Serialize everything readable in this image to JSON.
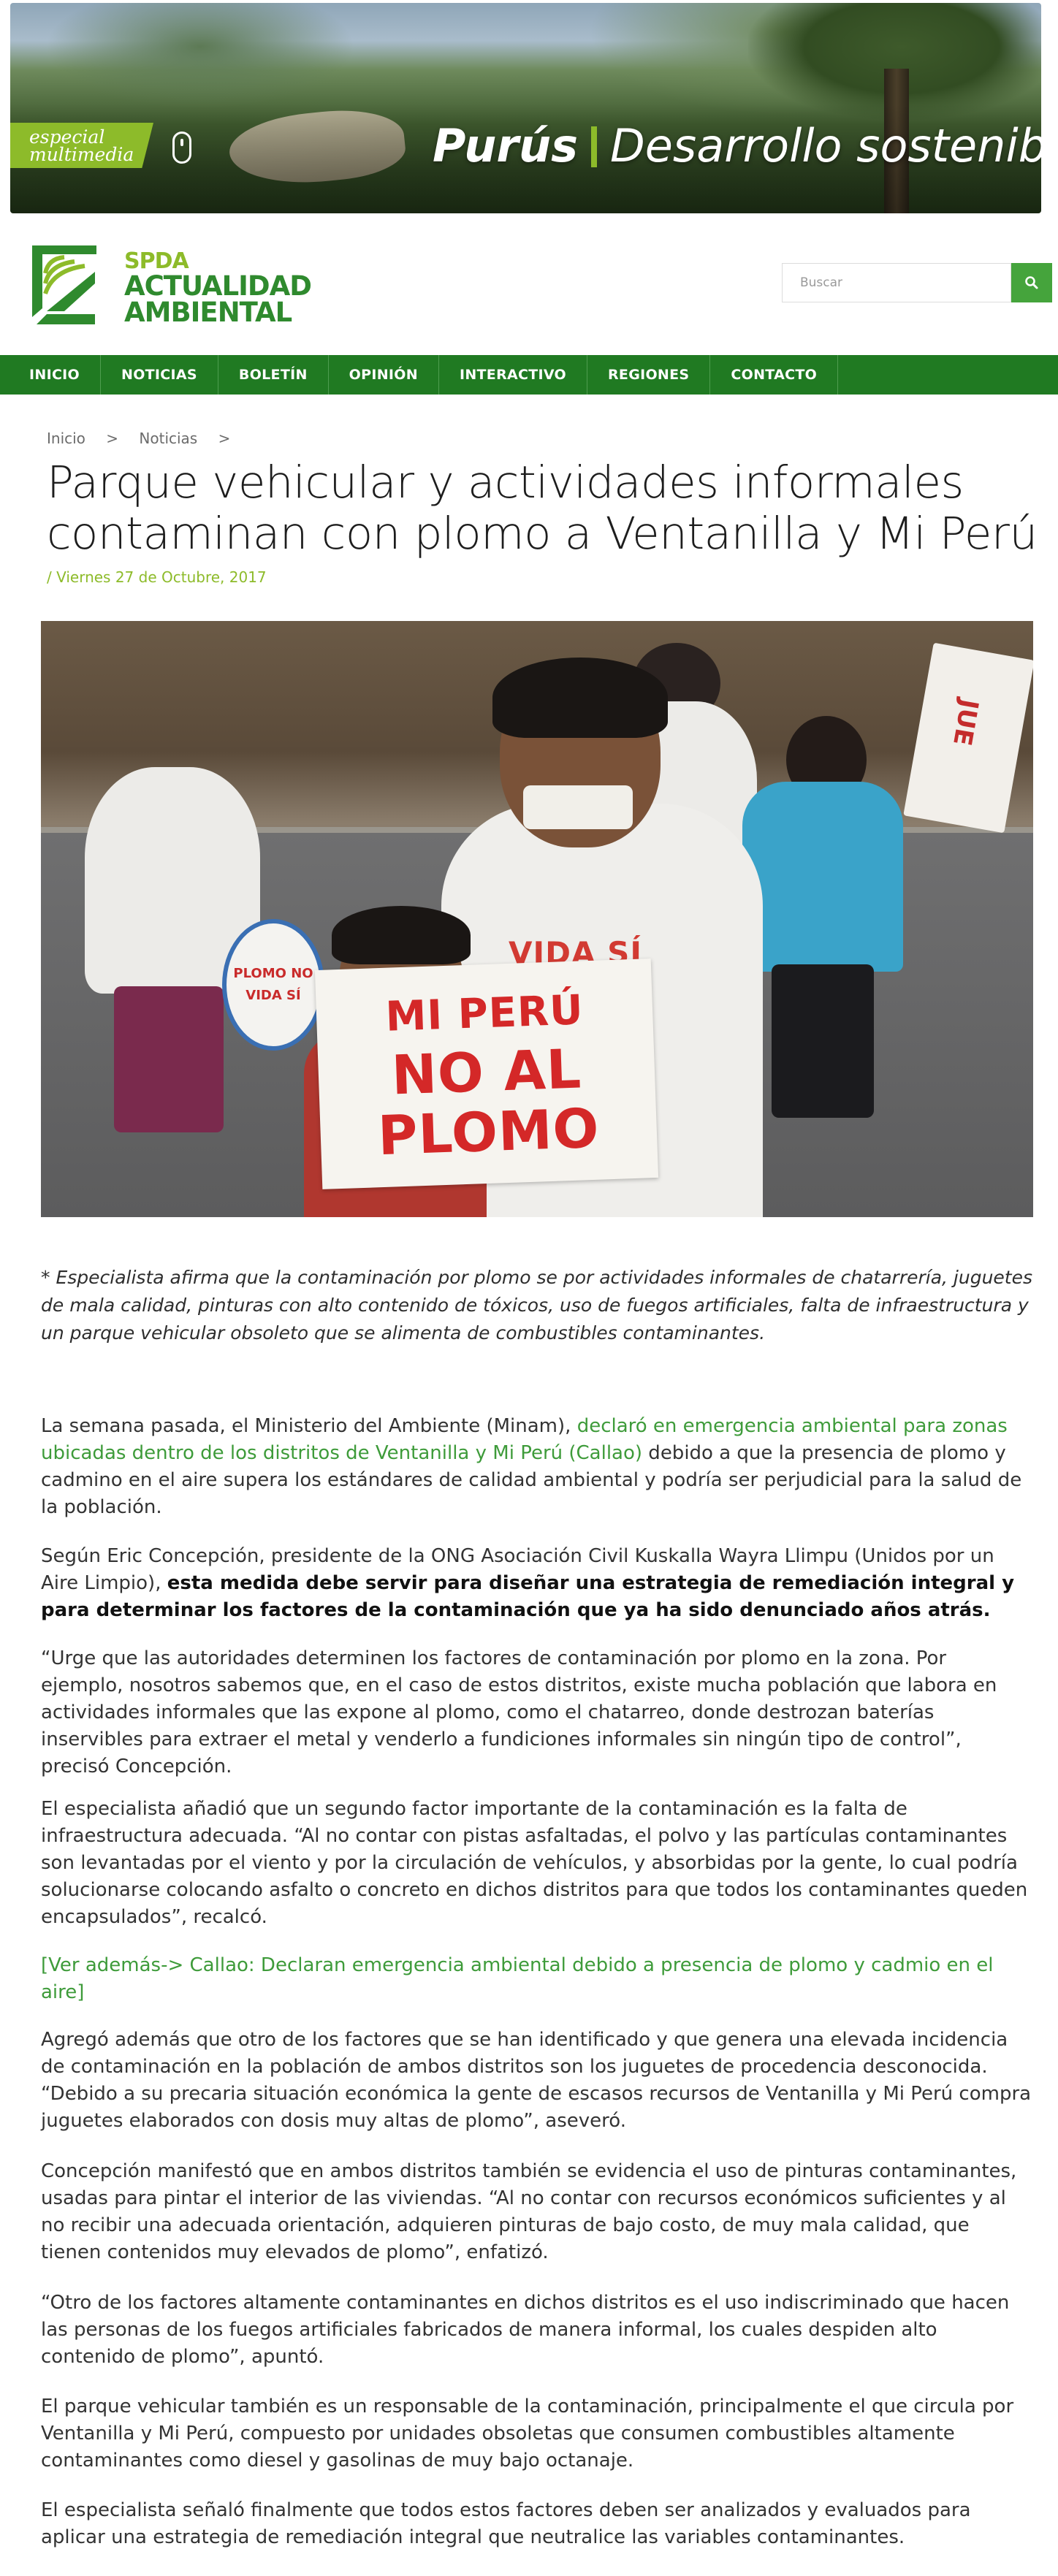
{
  "banner": {
    "badge_line1": "especial",
    "badge_line2": "multimedia",
    "title_bold": "Purús",
    "title_light": "Desarrollo sostenible"
  },
  "logo": {
    "line1": "SPDA",
    "line2": "ACTUALIDAD",
    "line3": "AMBIENTAL"
  },
  "search": {
    "placeholder": "Buscar"
  },
  "nav": {
    "items": [
      "INICIO",
      "NOTICIAS",
      "BOLETÍN",
      "OPINIÓN",
      "INTERACTIVO",
      "REGIONES",
      "CONTACTO"
    ]
  },
  "breadcrumb": {
    "home": "Inicio",
    "section": "Noticias",
    "separator": ">"
  },
  "article": {
    "title": "Parque vehicular y actividades informales contaminan con plomo a Ventanilla y Mi Perú",
    "date": "/ Viernes 27 de Octubre, 2017",
    "photo_text": {
      "oval_top": "PLOMO NO",
      "oval_bottom": "VIDA SÍ",
      "sign_line1": "VIDA SÍ",
      "sign_line2": "MI PERÚ",
      "sign_line3": "NO AL",
      "sign_line4": "PLOMO",
      "flag": "JUE"
    },
    "lead": "* Especialista afirma que la contaminación por plomo se por actividades informales de chatarrería, juguetes de mala calidad, pinturas con alto contenido de tóxicos, uso de fuegos artificiales, falta de infraestructura y un parque vehicular obsoleto que se alimenta de combustibles contaminantes.",
    "p1_a": "La semana pasada, el Ministerio del Ambiente (Minam), ",
    "p1_link": "declaró en emergencia ambiental para zonas ubicadas dentro de los distritos de Ventanilla y Mi Perú (Callao)",
    "p1_b": " debido a que la presencia de plomo y cadmino en el aire supera los estándares de calidad ambiental y podría ser perjudicial para la salud de la población.",
    "p2_a": "Según Eric Concepción, presidente de la ONG Asociación Civil Kuskalla Wayra Llimpu (Unidos por un Aire Limpio), ",
    "p2_strong": "esta medida debe servir para diseñar una estrategia de remediación integral y para determinar los factores de la contaminación que ya ha sido denunciado años atrás.",
    "p3": "“Urge que las autoridades determinen los factores de contaminación por plomo en la zona. Por ejemplo, nosotros sabemos que, en el caso de estos distritos, existe mucha población que labora en actividades informales que las expone al plomo, como el chatarreo, donde destrozan baterías inservibles para extraer el metal y venderlo a fundiciones informales sin ningún tipo de control”, precisó Concepción.",
    "p4": "El especialista añadió que un segundo factor importante de la contaminación es la falta de infraestructura adecuada. “Al no contar con pistas asfaltadas, el polvo y las partículas contaminantes son levantadas por el viento y por la circulación de vehículos, y absorbidas por la gente, lo cual podría solucionarse colocando asfalto o concreto en dichos distritos para que todos los contaminantes queden encapsulados”, recalcó.",
    "p5_link": "[Ver además-> Callao: Declaran emergencia ambiental debido a presencia de plomo y cadmio en el aire]",
    "p6": "Agregó además que otro de los factores que se han identificado y que genera una elevada incidencia de contaminación en la población de ambos distritos son los juguetes de procedencia desconocida. “Debido a su precaria situación económica la gente de escasos recursos de Ventanilla y Mi Perú compra juguetes elaborados con dosis muy altas de plomo”, aseveró.",
    "p7": "Concepción manifestó que en ambos distritos también se evidencia el uso de pinturas contaminantes, usadas para pintar el interior de las viviendas. “Al no contar con recursos económicos suficientes y al no recibir una adecuada orientación, adquieren pinturas de bajo costo, de muy mala calidad, que tienen contenidos muy elevados de plomo”, enfatizó.",
    "p8": "“Otro de los factores altamente contaminantes en dichos distritos es el uso indiscriminado que hacen las personas de los fuegos artificiales fabricados de manera informal, los cuales despiden alto contenido de plomo”, apuntó.",
    "p9": "El parque vehicular también es un responsable de la contaminación, principalmente el que circula por Ventanilla y Mi Perú, compuesto por unidades obsoletas que consumen combustibles altamente contaminantes como diesel y gasolinas de muy bajo octanaje.",
    "p10": "El especialista señaló finalmente que todos estos factores deben ser analizados y evaluados para aplicar una estrategia de remediación integral que neutralice las variables contaminantes."
  },
  "colors": {
    "nav_green": "#207a22",
    "accent_green": "#8dbb2a",
    "link_green": "#3e9b3a",
    "search_button": "#45a43c"
  }
}
